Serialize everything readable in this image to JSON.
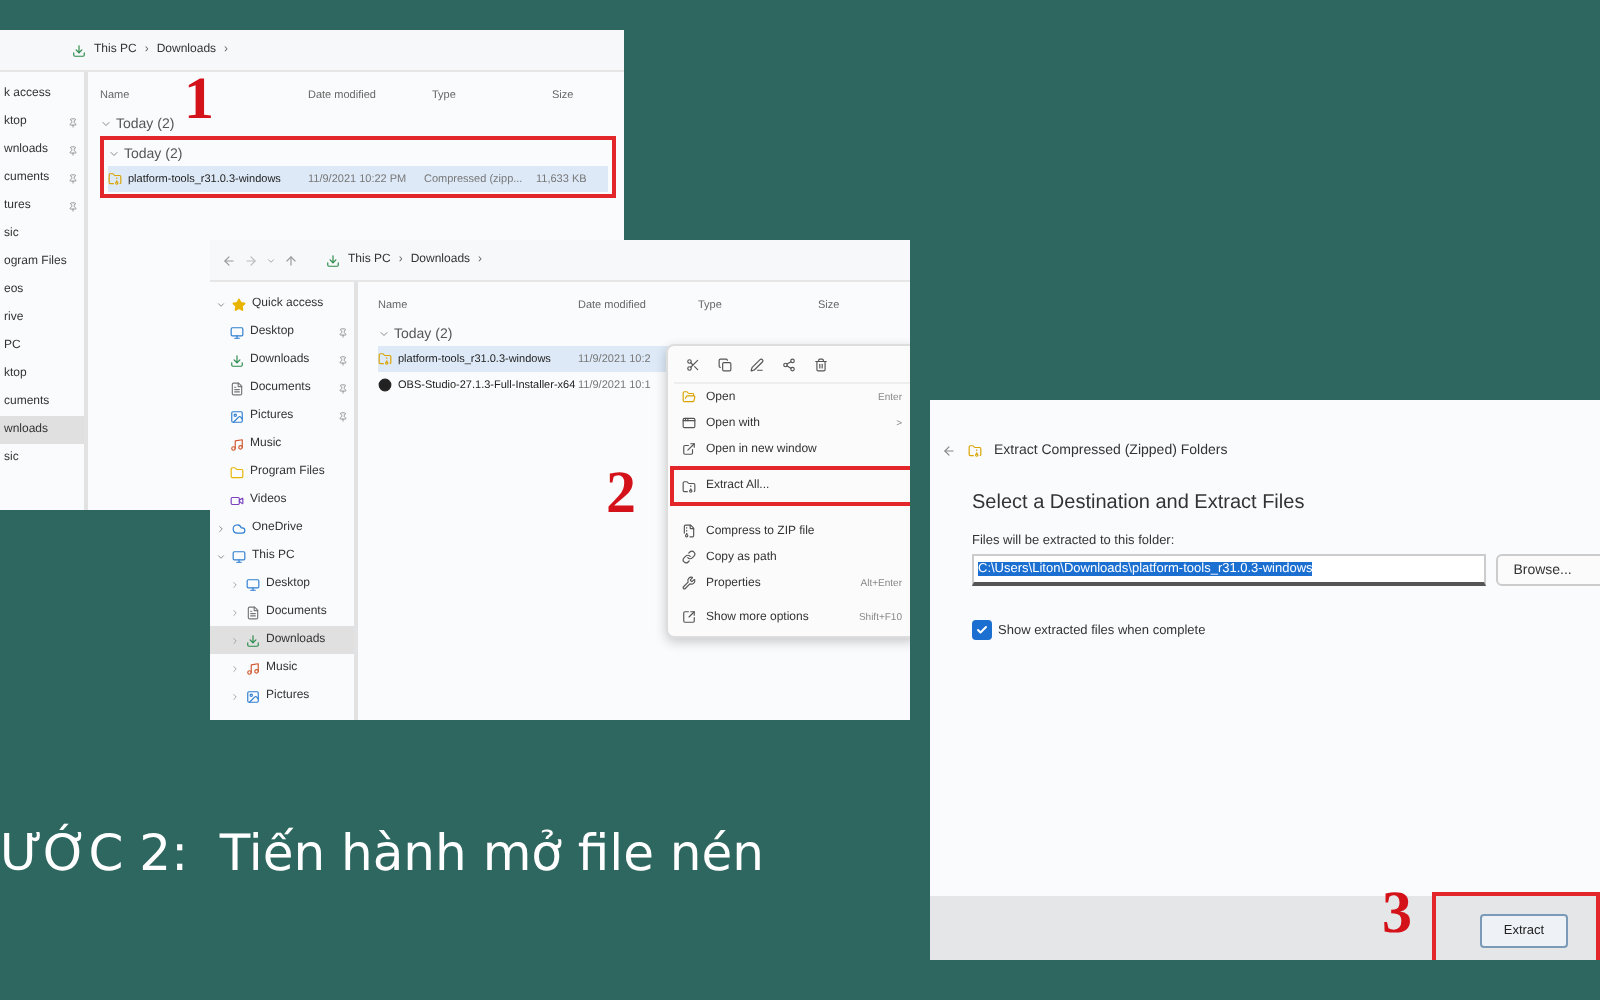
{
  "step1": {
    "number": "1",
    "breadcrumb": [
      "This PC",
      "Downloads"
    ],
    "separator": "›",
    "columns": [
      "Name",
      "Date modified",
      "Type",
      "Size"
    ],
    "group": "Today (2)",
    "boxed_group": "Today (2)",
    "sidebar": [
      {
        "label": "k access",
        "pinned": false,
        "selected": false
      },
      {
        "label": "ktop",
        "pinned": true,
        "selected": false
      },
      {
        "label": "wnloads",
        "pinned": true,
        "selected": false
      },
      {
        "label": "cuments",
        "pinned": true,
        "selected": false
      },
      {
        "label": "tures",
        "pinned": true,
        "selected": false
      },
      {
        "label": "sic",
        "pinned": false,
        "selected": false
      },
      {
        "label": "ogram Files",
        "pinned": false,
        "selected": false
      },
      {
        "label": "eos",
        "pinned": false,
        "selected": false
      },
      {
        "label": "rive",
        "pinned": false,
        "selected": false
      },
      {
        "label": "PC",
        "pinned": false,
        "selected": false
      },
      {
        "label": "ktop",
        "pinned": false,
        "selected": false
      },
      {
        "label": "cuments",
        "pinned": false,
        "selected": false
      },
      {
        "label": "wnloads",
        "pinned": false,
        "selected": true
      },
      {
        "label": "sic",
        "pinned": false,
        "selected": false
      }
    ],
    "row": {
      "name": "platform-tools_r31.0.3-windows",
      "date": "11/9/2021 10:22 PM",
      "type": "Compressed (zipp...",
      "size": "11,633 KB",
      "selected": true
    }
  },
  "step2": {
    "number": "2",
    "breadcrumb": [
      "This PC",
      "Downloads"
    ],
    "separator": "›",
    "columns": [
      "Name",
      "Date modified",
      "Type",
      "Size"
    ],
    "group": "Today (2)",
    "sidebar": [
      {
        "label": "Quick access",
        "kind": "star",
        "pinned": false,
        "selected": false,
        "expanded": true,
        "children": [
          {
            "label": "Desktop",
            "kind": "desktop",
            "pinned": true,
            "selected": false
          },
          {
            "label": "Downloads",
            "kind": "download",
            "pinned": true,
            "selected": false
          },
          {
            "label": "Documents",
            "kind": "document",
            "pinned": true,
            "selected": false
          },
          {
            "label": "Pictures",
            "kind": "picture",
            "pinned": true,
            "selected": false
          },
          {
            "label": "Music",
            "kind": "music",
            "pinned": false,
            "selected": false
          },
          {
            "label": "Program Files",
            "kind": "folder",
            "pinned": false,
            "selected": false
          },
          {
            "label": "Videos",
            "kind": "video",
            "pinned": false,
            "selected": false
          }
        ]
      },
      {
        "label": "OneDrive",
        "kind": "cloud",
        "pinned": false,
        "selected": false,
        "expanded": false
      },
      {
        "label": "This PC",
        "kind": "desktop",
        "pinned": false,
        "selected": false,
        "expanded": true,
        "children": [
          {
            "label": "Desktop",
            "kind": "desktop",
            "pinned": false,
            "selected": false
          },
          {
            "label": "Documents",
            "kind": "document",
            "pinned": false,
            "selected": false
          },
          {
            "label": "Downloads",
            "kind": "download",
            "pinned": false,
            "selected": true
          },
          {
            "label": "Music",
            "kind": "music",
            "pinned": false,
            "selected": false
          },
          {
            "label": "Pictures",
            "kind": "picture",
            "pinned": false,
            "selected": false
          }
        ]
      }
    ],
    "rows": [
      {
        "name": "platform-tools_r31.0.3-windows",
        "date": "11/9/2021 10:2",
        "kind": "zip",
        "selected": true
      },
      {
        "name": "OBS-Studio-27.1.3-Full-Installer-x64",
        "date": "11/9/2021 10:1",
        "kind": "app",
        "selected": false
      }
    ],
    "menu": [
      {
        "label": "Open",
        "shortcut": "Enter",
        "kind": "open",
        "highlighted": false
      },
      {
        "label": "Open with",
        "shortcut": ">",
        "kind": "openwith",
        "highlighted": false
      },
      {
        "label": "Open in new window",
        "kind": "newwindow",
        "highlighted": false
      },
      {
        "label": "Extract All...",
        "kind": "extract",
        "highlighted": true
      },
      {
        "label": "Compress to ZIP file",
        "kind": "zip",
        "highlighted": false
      },
      {
        "label": "Copy as path",
        "kind": "path",
        "highlighted": false
      },
      {
        "label": "Properties",
        "shortcut": "Alt+Enter",
        "kind": "properties",
        "highlighted": false
      },
      {
        "label": "Show more options",
        "shortcut": "Shift+F10",
        "kind": "more",
        "highlighted": false
      }
    ]
  },
  "step3": {
    "number": "3",
    "title": "Extract Compressed (Zipped) Folders",
    "heading": "Select a Destination and Extract Files",
    "field_label": "Files will be extracted to this folder:",
    "path": "C:\\Users\\Liton\\Downloads\\platform-tools_r31.0.3-windows",
    "browse": "Browse...",
    "checkbox": {
      "label": "Show extracted files when complete",
      "checked": true
    },
    "button": "Extract"
  },
  "caption": "ƯỚC 2:  Tiến hành mở file nén"
}
